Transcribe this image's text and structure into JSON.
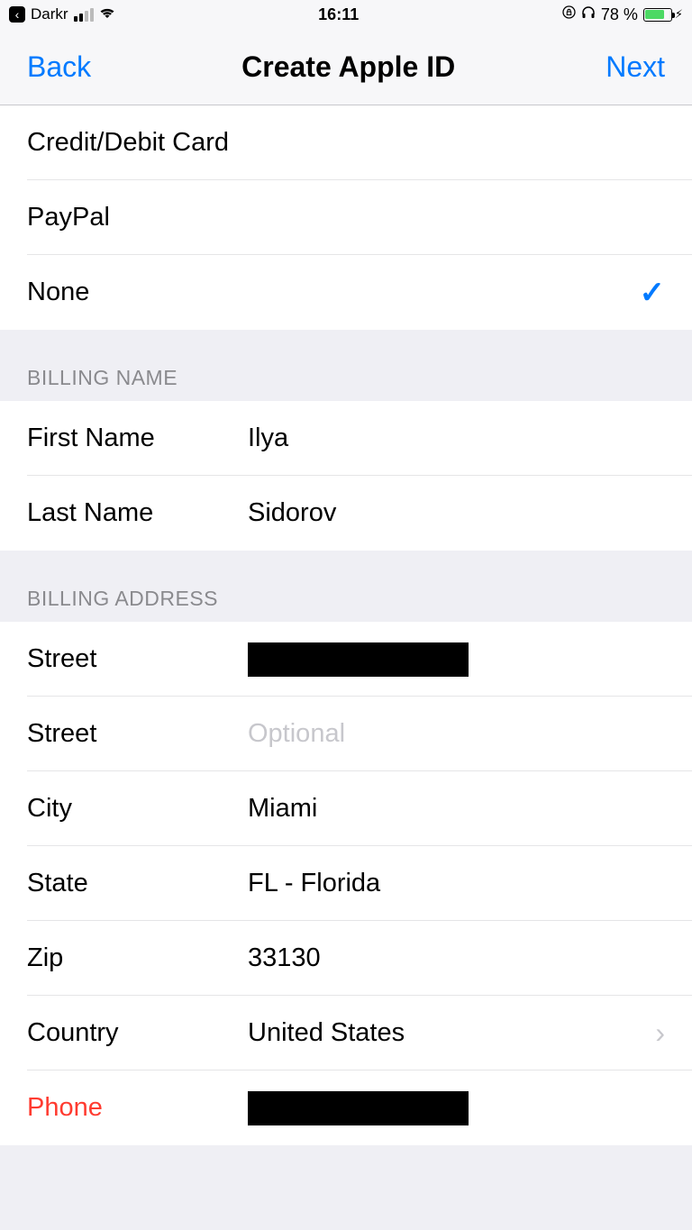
{
  "status": {
    "carrier": "Darkr",
    "time": "16:11",
    "battery": "78 %",
    "battery_fill_pct": 78
  },
  "nav": {
    "back": "Back",
    "title": "Create Apple ID",
    "next": "Next"
  },
  "payment": {
    "options": [
      {
        "label": "Credit/Debit Card",
        "selected": false
      },
      {
        "label": "PayPal",
        "selected": false
      },
      {
        "label": "None",
        "selected": true
      }
    ]
  },
  "billing_name": {
    "header": "BILLING NAME",
    "first_name_label": "First Name",
    "first_name_value": "Ilya",
    "last_name_label": "Last Name",
    "last_name_value": "Sidorov"
  },
  "billing_address": {
    "header": "BILLING ADDRESS",
    "street1_label": "Street",
    "street2_label": "Street",
    "street2_placeholder": "Optional",
    "city_label": "City",
    "city_value": "Miami",
    "state_label": "State",
    "state_value": "FL - Florida",
    "zip_label": "Zip",
    "zip_value": "33130",
    "country_label": "Country",
    "country_value": "United States",
    "phone_label": "Phone"
  }
}
